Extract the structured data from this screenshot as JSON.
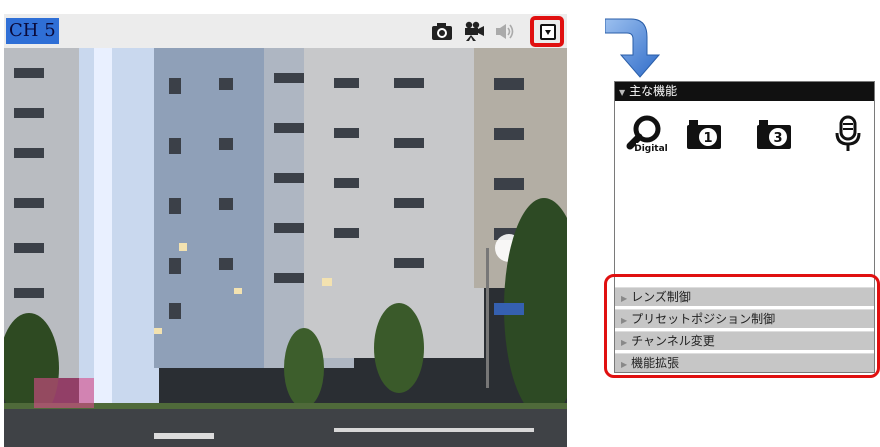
{
  "viewer": {
    "channel": "CH 5",
    "toolbar_icons": [
      "camera-icon",
      "video-record-icon",
      "speaker-icon",
      "menu-dropdown-icon"
    ]
  },
  "panel": {
    "title": "主な機能",
    "functions": [
      {
        "icon": "digital-zoom-icon",
        "label": "Digital"
      },
      {
        "icon": "snapshot-1-icon",
        "label": "1"
      },
      {
        "icon": "snapshot-3-icon",
        "label": "3"
      },
      {
        "icon": "microphone-icon",
        "label": ""
      }
    ],
    "collapsed_sections": [
      "レンズ制御",
      "プリセットポジション制御",
      "チャンネル変更",
      "機能拡張"
    ]
  },
  "colors": {
    "highlight": "#e01010",
    "channel_bg": "#2f6fd6",
    "arrow": "#3a7ad8"
  }
}
